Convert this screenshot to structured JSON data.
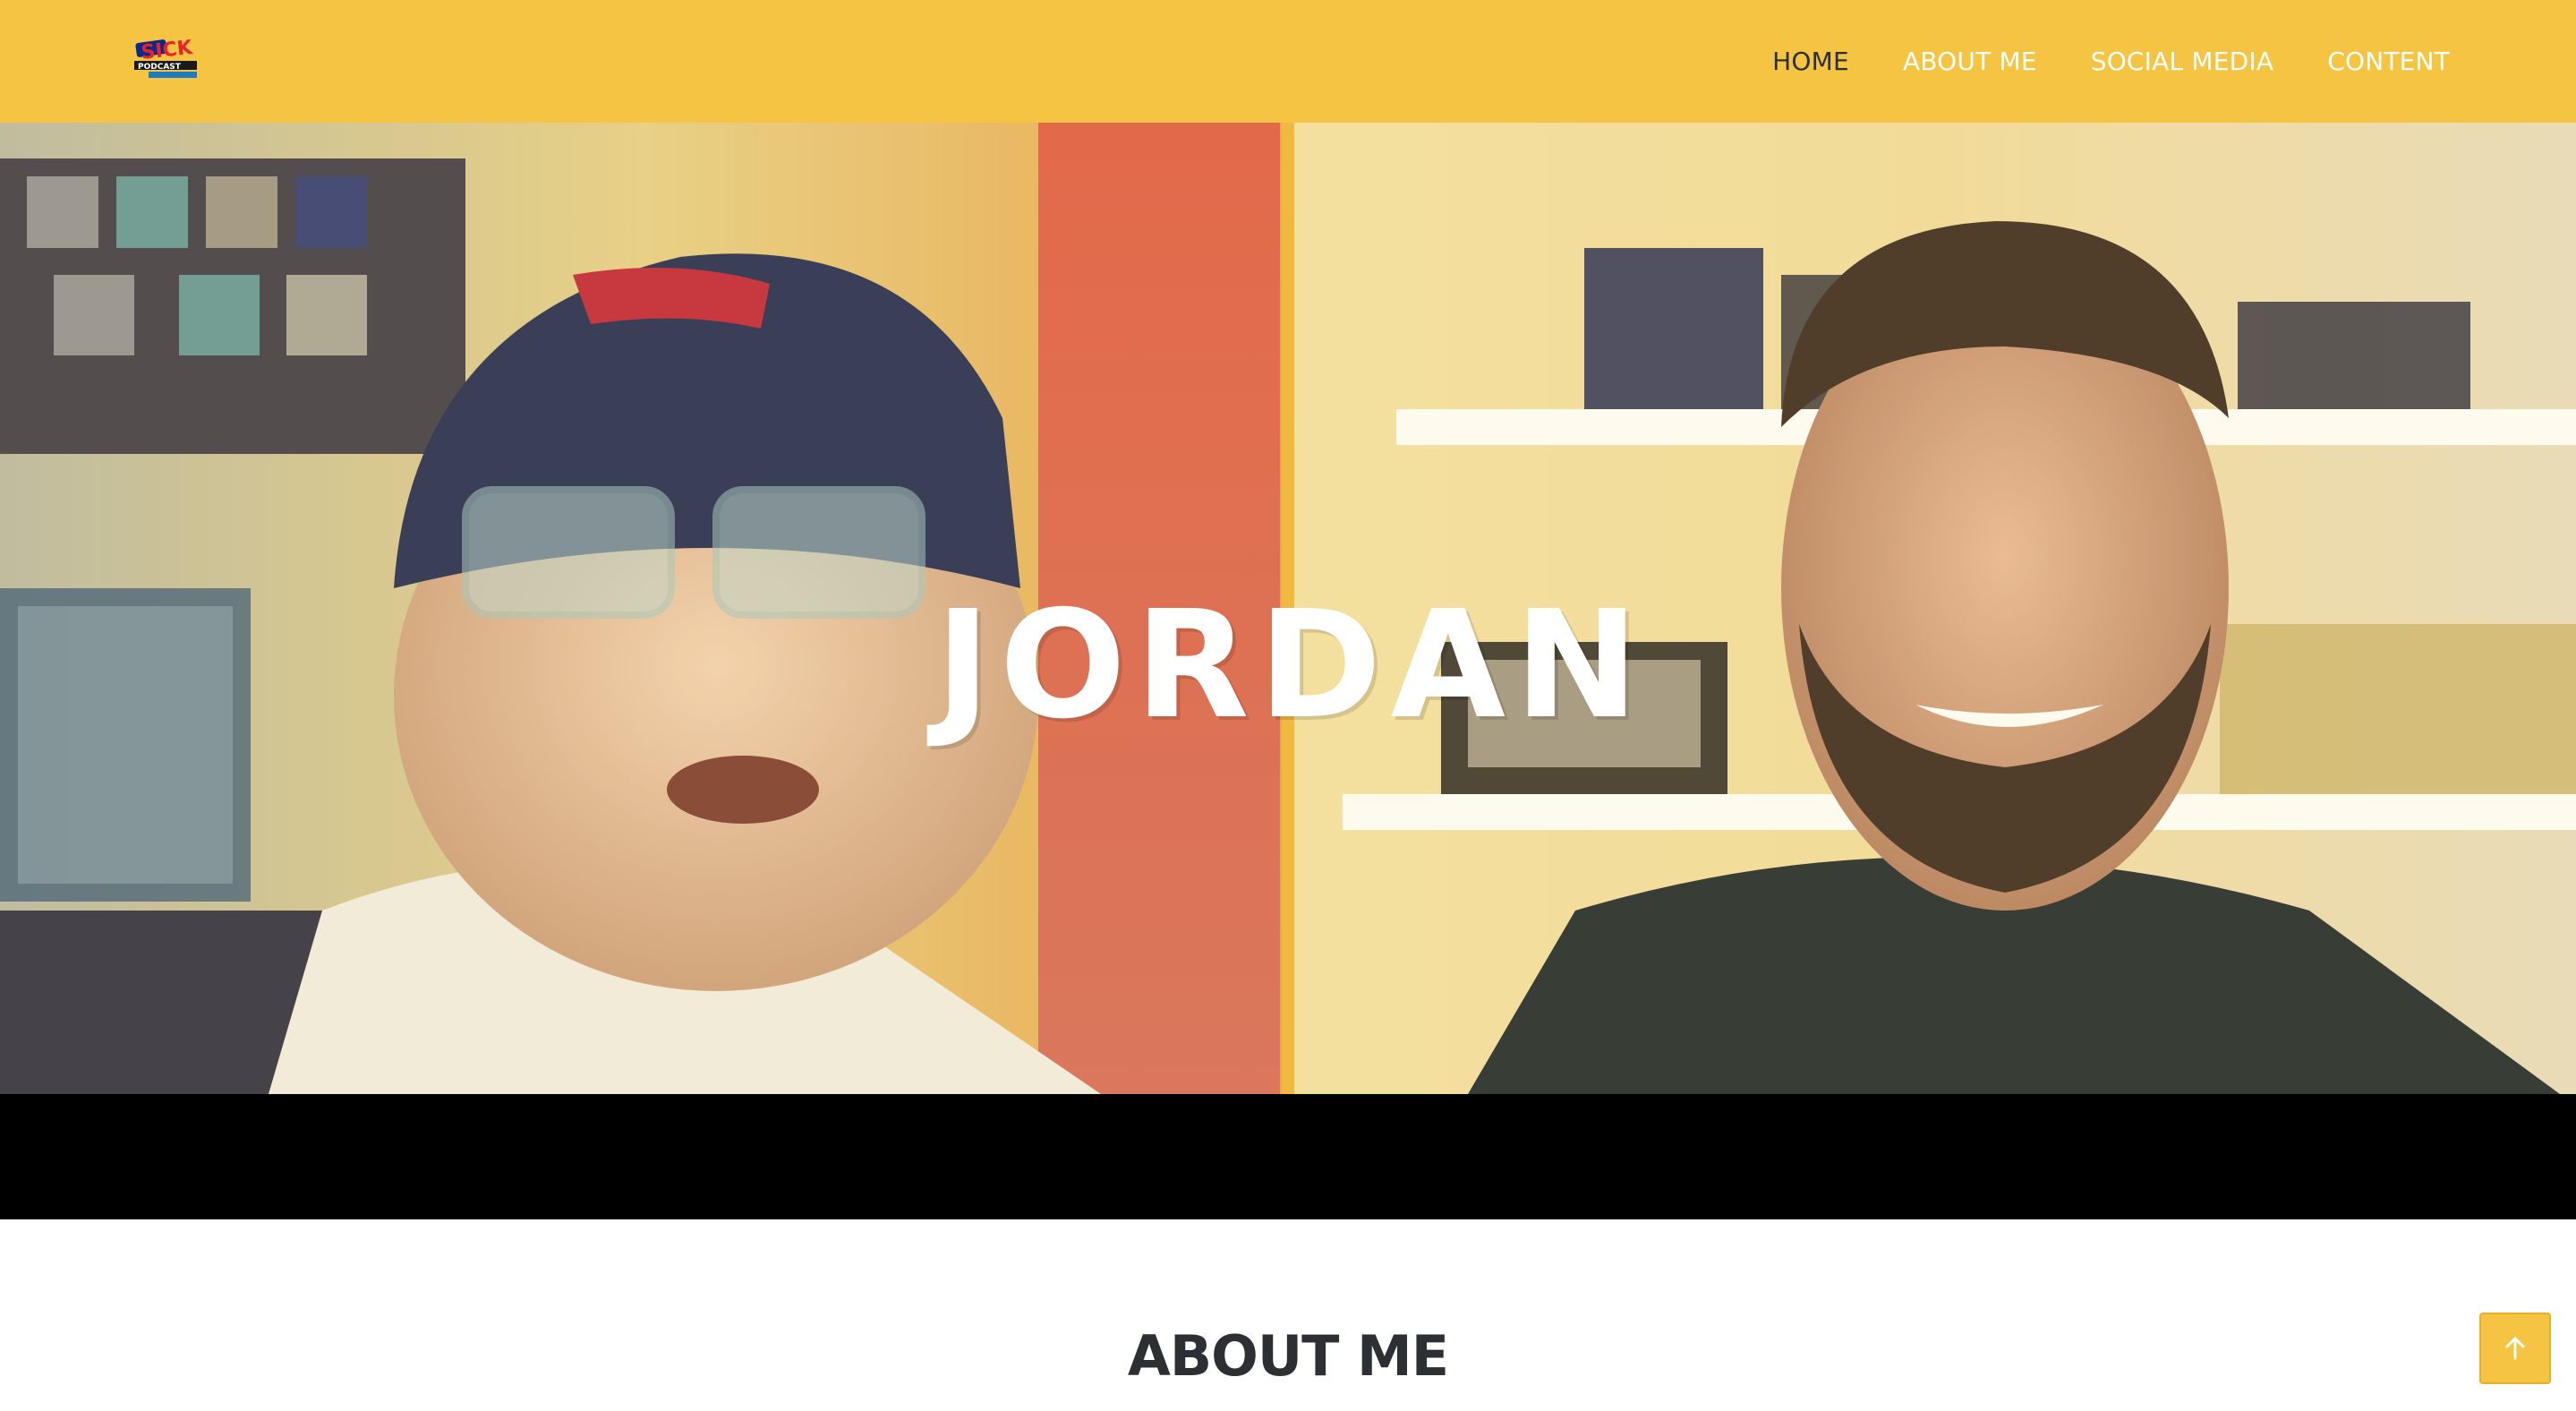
{
  "header": {
    "logo_alt": "The Sick Podcast",
    "nav": [
      {
        "label": "HOME",
        "active": true
      },
      {
        "label": "ABOUT ME",
        "active": false
      },
      {
        "label": "SOCIAL MEDIA",
        "active": false
      },
      {
        "label": "CONTENT",
        "active": false
      }
    ]
  },
  "hero": {
    "title": "JORDAN"
  },
  "about": {
    "heading": "ABOUT ME"
  },
  "back_to_top": {
    "icon": "arrow-up-icon",
    "label": "Back to top"
  },
  "colors": {
    "header_bg": "#f6c443",
    "nav_active": "#2c3034",
    "nav_default": "#ffffff",
    "heading": "#2c3034"
  }
}
